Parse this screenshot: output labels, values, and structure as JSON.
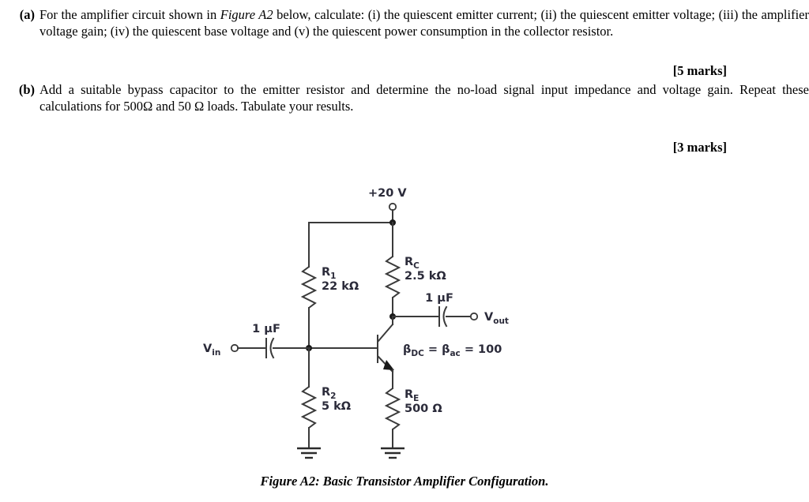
{
  "document": {
    "questions": [
      {
        "label": "(a)",
        "text_before_ref": "For the amplifier circuit shown in ",
        "figure_ref": "Figure A2",
        "text_after_ref": " below, calculate: (i) the quiescent emitter current; (ii) the quiescent emitter voltage; (iii) the amplifier voltage gain; (iv) the quiescent base voltage and (v) the quiescent power consumption in the collector resistor.",
        "marks": "[5 marks]"
      },
      {
        "label": "(b)",
        "text": "Add a suitable bypass capacitor to the emitter resistor and determine the no-load signal input impedance and voltage gain. Repeat these calculations for 500Ω and 50 Ω loads. Tabulate your results.",
        "marks": "[3 marks]"
      }
    ],
    "figure": {
      "caption": "Figure A2: Basic Transistor Amplifier Configuration.",
      "supply_label": "+20 V",
      "input_terminal_label": "V",
      "input_terminal_sub": "in",
      "output_terminal_label": "V",
      "output_terminal_sub": "out",
      "input_cap_value": "1 µF",
      "output_cap_value": "1 µF",
      "components": [
        {
          "name": "R",
          "sub": "1",
          "value": "22 kΩ"
        },
        {
          "name": "R",
          "sub": "2",
          "value": "5 kΩ"
        },
        {
          "name": "R",
          "sub": "C",
          "value": "2.5 kΩ"
        },
        {
          "name": "R",
          "sub": "E",
          "value": "500 Ω"
        }
      ],
      "beta": {
        "symbol1": "β",
        "sub1": "DC",
        "eq1": " = ",
        "symbol2": "β",
        "sub2": "ac",
        "eq2": " = 100"
      }
    },
    "colors": {
      "wire": "#3a3a3a",
      "label": "#2b2b3a",
      "text": "#000000",
      "background": "#ffffff"
    }
  }
}
